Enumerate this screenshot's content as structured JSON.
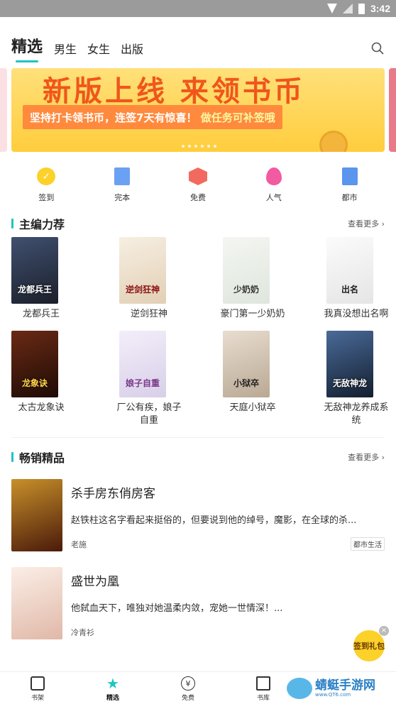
{
  "status": {
    "time": "3:42"
  },
  "tabs": [
    "精选",
    "男生",
    "女生",
    "出版"
  ],
  "banner": {
    "title": "新版上线 来领书币",
    "subtitle_main": "坚持打卡领书币，连签7天有惊喜！",
    "subtitle_tail": "做任务可补签哦"
  },
  "quick": [
    {
      "label": "签到",
      "icon": "sign-icon"
    },
    {
      "label": "完本",
      "icon": "book-icon"
    },
    {
      "label": "免费",
      "icon": "free-icon"
    },
    {
      "label": "人气",
      "icon": "fire-icon"
    },
    {
      "label": "都市",
      "icon": "city-icon"
    }
  ],
  "editor": {
    "title": "主编力荐",
    "more": "查看更多 ›",
    "books": [
      {
        "name": "龙都兵王",
        "cover_text": "龙都兵王",
        "color": "#2b3140"
      },
      {
        "name": "逆剑狂神",
        "cover_text": "逆剑狂神",
        "color": "#efe2cf"
      },
      {
        "name": "豪门第一少奶奶",
        "cover_text": "少奶奶",
        "color": "#e9ece8"
      },
      {
        "name": "我真没想出名啊",
        "cover_text": "出名",
        "color": "#f2f2f2"
      },
      {
        "name": "太古龙象诀",
        "cover_text": "龙象诀",
        "color": "#3a1a10"
      },
      {
        "name": "厂公有疾，娘子自重",
        "cover_text": "娘子自重",
        "color": "#e6dff0"
      },
      {
        "name": "天庭小狱卒",
        "cover_text": "小狱卒",
        "color": "#d8cdbf"
      },
      {
        "name": "无敌神龙养成系统",
        "cover_text": "无敌神龙",
        "color": "#2a3e5a"
      }
    ]
  },
  "bestseller": {
    "title": "畅销精品",
    "more": "查看更多 ›",
    "items": [
      {
        "title": "杀手房东俏房客",
        "desc": "赵铁柱这名字看起来挺俗的，但要说到他的绰号，魔影，在全球的杀...",
        "author": "老施",
        "tag": "都市生活",
        "color": "#7a3a1a"
      },
      {
        "title": "盛世为凰",
        "desc": "他弑血天下，唯独对她温柔内敛，宠她一世情深！...",
        "author": "冷青衫",
        "tag": "",
        "color": "#f1dfd6"
      }
    ]
  },
  "float": {
    "label": "签到礼包",
    "close": "×"
  },
  "bottom": [
    {
      "label": "书架",
      "icon": "bookshelf-icon"
    },
    {
      "label": "精选",
      "icon": "star-icon"
    },
    {
      "label": "免费",
      "icon": "yen-icon"
    },
    {
      "label": "书库",
      "icon": "library-icon"
    }
  ],
  "watermark": {
    "text": "蜻蜓手游网",
    "url": "www.QT6.com"
  }
}
